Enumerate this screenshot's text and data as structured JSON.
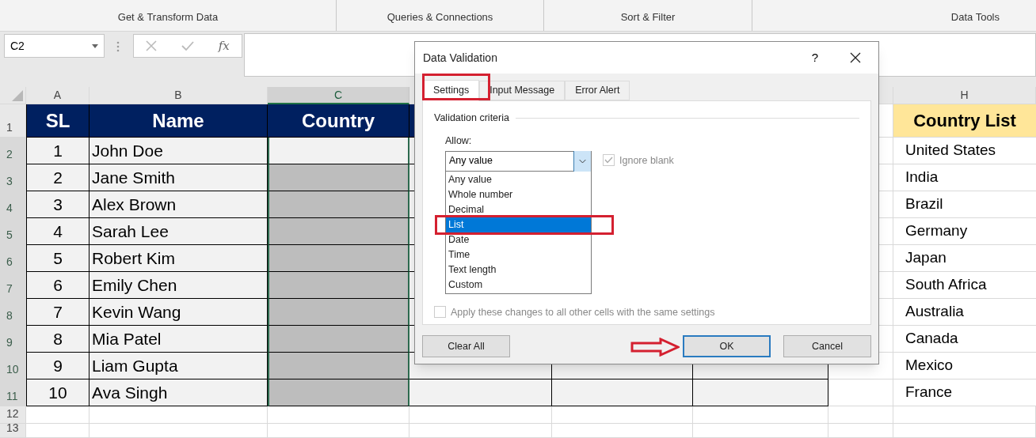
{
  "ribbon": {
    "groups": [
      {
        "label": "Get & Transform Data"
      },
      {
        "label": "Queries & Connections"
      },
      {
        "label": "Sort & Filter"
      },
      {
        "label": "Data Tools"
      }
    ]
  },
  "name_box": {
    "value": "C2"
  },
  "formula_bar": {
    "function_label": "fx"
  },
  "sheet": {
    "columns": [
      {
        "label": "A",
        "selected": false
      },
      {
        "label": "B",
        "selected": false
      },
      {
        "label": "C",
        "selected": true
      },
      {
        "label": "H",
        "selected": false
      }
    ],
    "header": {
      "row_number": "1",
      "sl": "SL",
      "name": "Name",
      "country": "Country",
      "country_list": "Country List"
    },
    "rows": [
      {
        "row_number": "2",
        "sl": "1",
        "name": "John Doe",
        "selected": false,
        "country_list_item": "United States"
      },
      {
        "row_number": "3",
        "sl": "2",
        "name": "Jane Smith",
        "selected": true,
        "country_list_item": "India"
      },
      {
        "row_number": "4",
        "sl": "3",
        "name": "Alex Brown",
        "selected": true,
        "country_list_item": "Brazil"
      },
      {
        "row_number": "5",
        "sl": "4",
        "name": "Sarah Lee",
        "selected": true,
        "country_list_item": "Germany"
      },
      {
        "row_number": "6",
        "sl": "5",
        "name": "Robert Kim",
        "selected": true,
        "country_list_item": "Japan"
      },
      {
        "row_number": "7",
        "sl": "6",
        "name": "Emily Chen",
        "selected": true,
        "country_list_item": "South Africa"
      },
      {
        "row_number": "8",
        "sl": "7",
        "name": "Kevin Wang",
        "selected": true,
        "country_list_item": "Australia"
      },
      {
        "row_number": "9",
        "sl": "8",
        "name": "Mia Patel",
        "selected": true,
        "country_list_item": "Canada"
      },
      {
        "row_number": "10",
        "sl": "9",
        "name": "Liam Gupta",
        "selected": true,
        "country_list_item": "Mexico"
      },
      {
        "row_number": "11",
        "sl": "10",
        "name": "Ava Singh",
        "selected": true,
        "country_list_item": "France"
      }
    ],
    "empty_rows": [
      "12",
      "13"
    ]
  },
  "dialog": {
    "title": "Data Validation",
    "help": "?",
    "tabs": [
      {
        "label": "Settings",
        "selected": true
      },
      {
        "label": "Input Message",
        "selected": false
      },
      {
        "label": "Error Alert",
        "selected": false
      }
    ],
    "group_label": "Validation criteria",
    "allow_label": "Allow:",
    "allow_value": "Any value",
    "ignore_blank": {
      "label": "Ignore blank",
      "checked": true,
      "disabled": true
    },
    "options": [
      {
        "label": "Any value",
        "selected": false
      },
      {
        "label": "Whole number",
        "selected": false
      },
      {
        "label": "Decimal",
        "selected": false
      },
      {
        "label": "List",
        "selected": true
      },
      {
        "label": "Date",
        "selected": false
      },
      {
        "label": "Time",
        "selected": false
      },
      {
        "label": "Text length",
        "selected": false
      },
      {
        "label": "Custom",
        "selected": false
      }
    ],
    "apply_all": {
      "label": "Apply these changes to all other cells with the same settings",
      "checked": false,
      "disabled": true
    },
    "buttons": [
      {
        "label": "Clear All",
        "kind": "secondary"
      },
      {
        "label": "OK",
        "kind": "default"
      },
      {
        "label": "Cancel",
        "kind": "secondary"
      }
    ]
  }
}
